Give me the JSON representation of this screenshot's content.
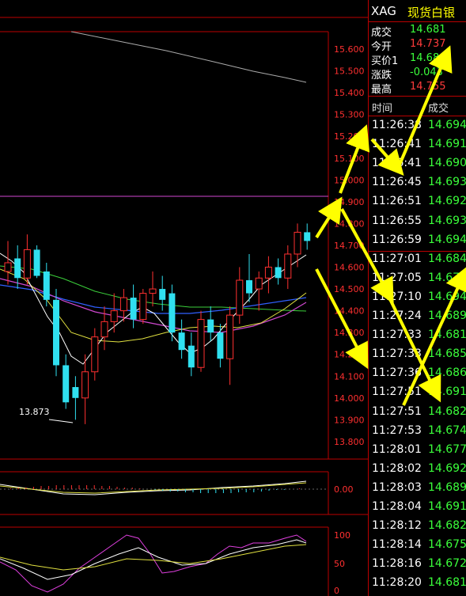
{
  "header": {
    "symbol": "XAG",
    "name": "现货白银"
  },
  "quote": [
    {
      "label": "成交",
      "value": "14.681",
      "color": "#3bff3b"
    },
    {
      "label": "今开",
      "value": "14.737",
      "color": "#ff3b3b"
    },
    {
      "label": "买价1",
      "value": "14.68",
      "color": "#3bff3b"
    },
    {
      "label": "涨跌",
      "value": "-0.043",
      "color": "#3bff3b"
    },
    {
      "label": "最高",
      "value": "14.755",
      "color": "#ff3b3b"
    }
  ],
  "ticks_header": {
    "time": "时间",
    "price": "成交"
  },
  "ticks": [
    {
      "time": "11:26:38",
      "price": "14.694"
    },
    {
      "time": "11:26:41",
      "price": "14.691"
    },
    {
      "time": "11:26:41",
      "price": "14.690"
    },
    {
      "time": "11:26:45",
      "price": "14.693"
    },
    {
      "time": "11:26:51",
      "price": "14.692"
    },
    {
      "time": "11:26:55",
      "price": "14.693"
    },
    {
      "time": "11:26:59",
      "price": "14.694"
    },
    {
      "time": "11:27:01",
      "price": "14.684"
    },
    {
      "time": "11:27:05",
      "price": "14.67"
    },
    {
      "time": "11:27:10",
      "price": "14.694"
    },
    {
      "time": "11:27:24",
      "price": "14.689"
    },
    {
      "time": "11:27:33",
      "price": "14.681"
    },
    {
      "time": "11:27:33",
      "price": "14.685"
    },
    {
      "time": "11:27:36",
      "price": "14.686"
    },
    {
      "time": "11:27:51",
      "price": "14.691"
    },
    {
      "time": "11:27:51",
      "price": "14.682"
    },
    {
      "time": "11:27:53",
      "price": "14.674"
    },
    {
      "time": "11:28:01",
      "price": "14.677"
    },
    {
      "time": "11:28:02",
      "price": "14.692"
    },
    {
      "time": "11:28:03",
      "price": "14.689"
    },
    {
      "time": "11:28:04",
      "price": "14.691"
    },
    {
      "time": "11:28:12",
      "price": "14.682"
    },
    {
      "time": "11:28:14",
      "price": "14.675"
    },
    {
      "time": "11:28:16",
      "price": "14.672"
    },
    {
      "time": "11:28:20",
      "price": "14.681"
    }
  ],
  "price_axis": [
    "15.600",
    "15.500",
    "15.400",
    "15.300",
    "15.200",
    "15.100",
    "15.000",
    "14.900",
    "14.800",
    "14.700",
    "14.600",
    "14.500",
    "14.400",
    "14.300",
    "14.200",
    "14.100",
    "14.000",
    "13.900",
    "13.800"
  ],
  "macd_axis": [
    "0.00"
  ],
  "kdj_axis": [
    "100",
    "50",
    "0"
  ],
  "low_marker": "13.873",
  "chart_data": {
    "type": "candlestick",
    "ylim": [
      13.75,
      15.65
    ],
    "candles": [
      {
        "o": 14.58,
        "h": 14.72,
        "l": 14.52,
        "c": 14.62
      },
      {
        "o": 14.64,
        "h": 14.7,
        "l": 14.5,
        "c": 14.55
      },
      {
        "o": 14.55,
        "h": 14.75,
        "l": 14.52,
        "c": 14.68
      },
      {
        "o": 14.68,
        "h": 14.7,
        "l": 14.55,
        "c": 14.56
      },
      {
        "o": 14.58,
        "h": 14.62,
        "l": 14.42,
        "c": 14.45
      },
      {
        "o": 14.45,
        "h": 14.5,
        "l": 14.1,
        "c": 14.15
      },
      {
        "o": 14.15,
        "h": 14.2,
        "l": 13.95,
        "c": 13.98
      },
      {
        "o": 14.05,
        "h": 14.1,
        "l": 13.9,
        "c": 14.0
      },
      {
        "o": 14.0,
        "h": 14.2,
        "l": 13.88,
        "c": 14.12
      },
      {
        "o": 14.12,
        "h": 14.32,
        "l": 14.08,
        "c": 14.28
      },
      {
        "o": 14.28,
        "h": 14.42,
        "l": 14.22,
        "c": 14.35
      },
      {
        "o": 14.35,
        "h": 14.48,
        "l": 14.3,
        "c": 14.4
      },
      {
        "o": 14.4,
        "h": 14.5,
        "l": 14.35,
        "c": 14.46
      },
      {
        "o": 14.46,
        "h": 14.52,
        "l": 14.32,
        "c": 14.36
      },
      {
        "o": 14.36,
        "h": 14.5,
        "l": 14.34,
        "c": 14.48
      },
      {
        "o": 14.48,
        "h": 14.58,
        "l": 14.42,
        "c": 14.5
      },
      {
        "o": 14.5,
        "h": 14.56,
        "l": 14.4,
        "c": 14.45
      },
      {
        "o": 14.48,
        "h": 14.52,
        "l": 14.26,
        "c": 14.3
      },
      {
        "o": 14.3,
        "h": 14.36,
        "l": 14.18,
        "c": 14.22
      },
      {
        "o": 14.24,
        "h": 14.3,
        "l": 14.1,
        "c": 14.14
      },
      {
        "o": 14.14,
        "h": 14.4,
        "l": 14.12,
        "c": 14.36
      },
      {
        "o": 14.36,
        "h": 14.42,
        "l": 14.26,
        "c": 14.3
      },
      {
        "o": 14.3,
        "h": 14.34,
        "l": 14.14,
        "c": 14.18
      },
      {
        "o": 14.18,
        "h": 14.42,
        "l": 14.06,
        "c": 14.38
      },
      {
        "o": 14.38,
        "h": 14.6,
        "l": 14.34,
        "c": 14.54
      },
      {
        "o": 14.54,
        "h": 14.66,
        "l": 14.44,
        "c": 14.48
      },
      {
        "o": 14.5,
        "h": 14.58,
        "l": 14.4,
        "c": 14.55
      },
      {
        "o": 14.55,
        "h": 14.65,
        "l": 14.48,
        "c": 14.6
      },
      {
        "o": 14.6,
        "h": 14.64,
        "l": 14.52,
        "c": 14.55
      },
      {
        "o": 14.55,
        "h": 14.7,
        "l": 14.5,
        "c": 14.66
      },
      {
        "o": 14.66,
        "h": 14.8,
        "l": 14.6,
        "c": 14.76
      },
      {
        "o": 14.76,
        "h": 14.8,
        "l": 14.68,
        "c": 14.72
      }
    ]
  }
}
